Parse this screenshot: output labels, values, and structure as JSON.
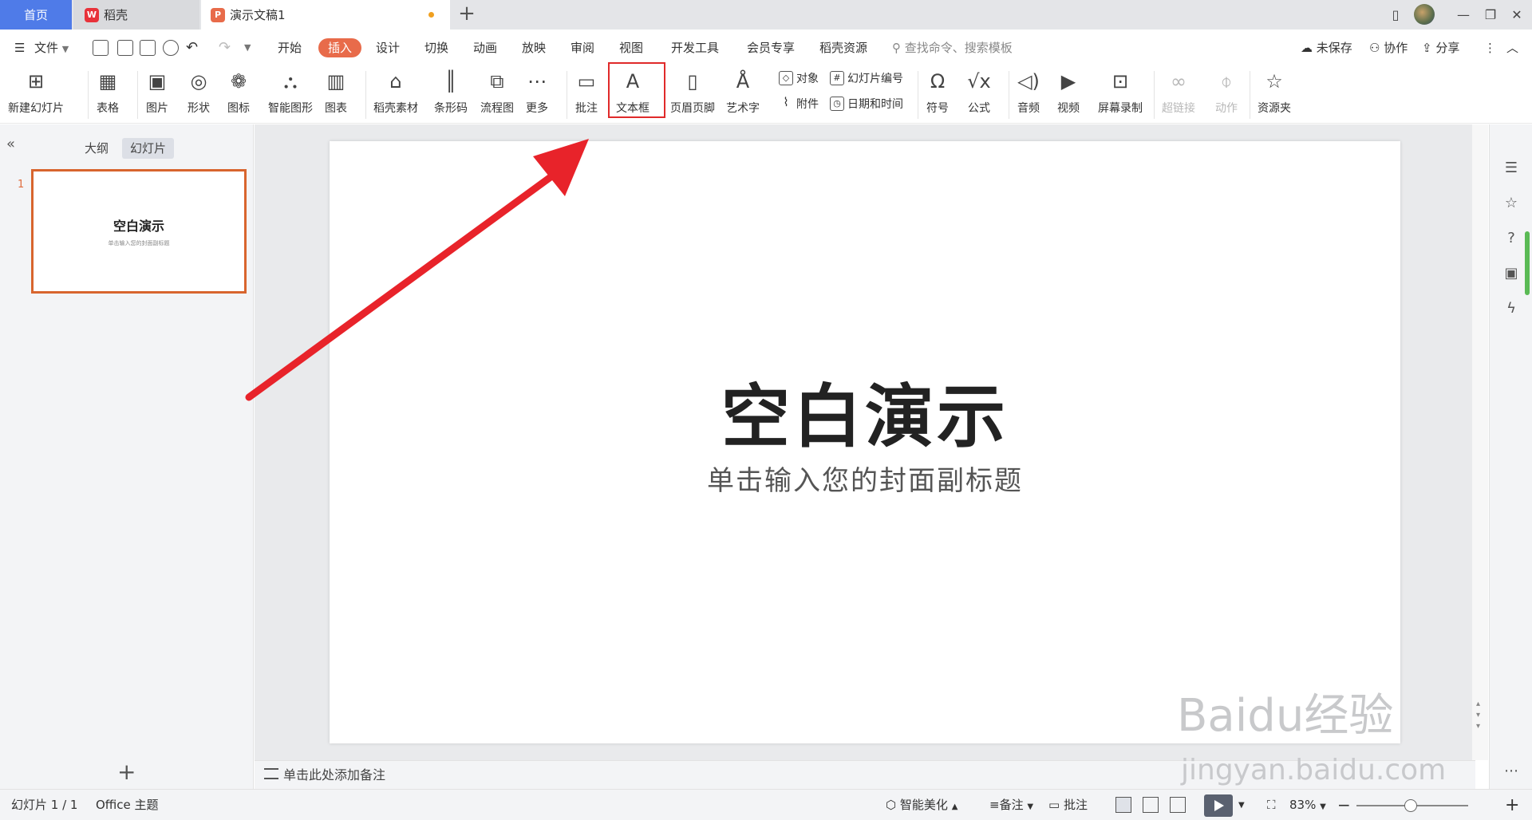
{
  "tabs": {
    "home": "首页",
    "wps": "稻壳",
    "doc": "演示文稿1",
    "new_tab": "+"
  },
  "menu": {
    "file": "文件",
    "items": [
      "开始",
      "插入",
      "设计",
      "切换",
      "动画",
      "放映",
      "审阅",
      "视图",
      "开发工具",
      "会员专享",
      "稻壳资源"
    ],
    "active": "插入",
    "search_placeholder": "查找命令、搜索模板",
    "unsaved": "未保存",
    "collab": "协作",
    "share": "分享"
  },
  "ribbon": {
    "new_slide": "新建幻灯片",
    "table": "表格",
    "picture": "图片",
    "shape": "形状",
    "icon": "图标",
    "smart_graphic": "智能图形",
    "chart": "图表",
    "material": "稻壳素材",
    "barcode": "条形码",
    "flowchart": "流程图",
    "more": "更多",
    "comment": "批注",
    "textbox": "文本框",
    "header_footer": "页眉页脚",
    "wordart": "艺术字",
    "object": "对象",
    "attachment": "附件",
    "slide_number": "幻灯片编号",
    "date_time": "日期和时间",
    "symbol": "符号",
    "formula": "公式",
    "audio": "音频",
    "video": "视频",
    "screen_record": "屏幕录制",
    "hyperlink": "超链接",
    "action": "动作",
    "resource": "资源夹"
  },
  "left_panel": {
    "tab_outline": "大纲",
    "tab_slides": "幻灯片",
    "slide_number": "1",
    "thumb_title": "空白演示",
    "thumb_subtitle": "单击输入您的封面副标题",
    "add": "+"
  },
  "slide": {
    "title": "空白演示",
    "subtitle": "单击输入您的封面副标题"
  },
  "notes": {
    "placeholder": "单击此处添加备注"
  },
  "statusbar": {
    "slide_info": "幻灯片 1 / 1",
    "theme": "Office 主题",
    "beautify": "智能美化",
    "notes": "备注",
    "comment": "批注",
    "zoom": "83%"
  },
  "watermark": {
    "brand": "Baidu经验",
    "url": "jingyan.baidu.com"
  },
  "colors": {
    "accent": "#e86b4a",
    "home_tab": "#4f7be8",
    "highlight": "#e02a2a",
    "arrow": "#e8232a"
  }
}
